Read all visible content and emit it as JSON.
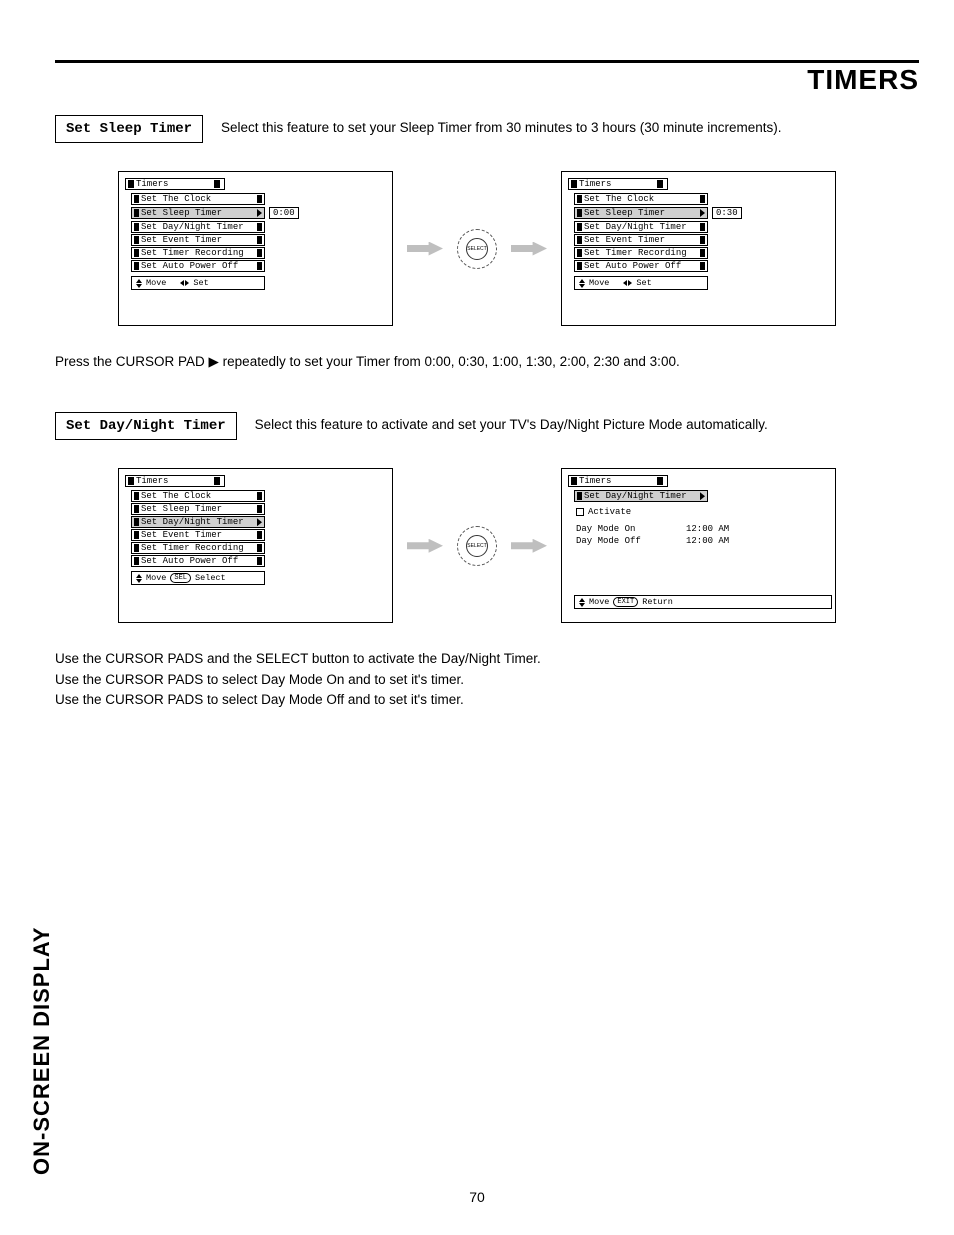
{
  "page_title": "TIMERS",
  "section_tab": "ON-SCREEN DISPLAY",
  "page_number": "70",
  "sleep": {
    "label": "Set Sleep Timer",
    "desc": "Select this feature to set your Sleep Timer from 30 minutes to 3 hours (30 minute increments).",
    "note": "Press the CURSOR PAD ▶ repeatedly to set your Timer from 0:00, 0:30, 1:00, 1:30, 2:00, 2:30 and 3:00.",
    "osd_title": "Timers",
    "items": {
      "clock": "Set The Clock",
      "sleep": "Set Sleep Timer",
      "daynight": "Set Day/Night Timer",
      "event": "Set Event Timer",
      "rec": "Set Timer Recording",
      "auto": "Set Auto Power Off"
    },
    "val_a": "0:00",
    "val_b": "0:30",
    "hint_move": "Move",
    "hint_set": "Set"
  },
  "daynight": {
    "label": "Set Day/Night Timer",
    "desc": "Select this feature to activate and set your TV's Day/Night Picture Mode automatically.",
    "note1": "Use the CURSOR PADS and the SELECT button to activate the Day/Night Timer.",
    "note2": "Use the CURSOR PADS to select Day Mode On and to set it's timer.",
    "note3": "Use the CURSOR PADS to select Day Mode Off and to set it's timer.",
    "osd_a_title": "Timers",
    "osd_b_title": "Timers",
    "osd_b_sub": "Set Day/Night Timer",
    "activate": "Activate",
    "mode_on": "Day Mode On",
    "mode_off": "Day Mode Off",
    "time": "12:00 AM",
    "hint_move": "Move",
    "hint_select": "Select",
    "hint_return": "Return"
  },
  "remote": {
    "label": "SELECT"
  }
}
